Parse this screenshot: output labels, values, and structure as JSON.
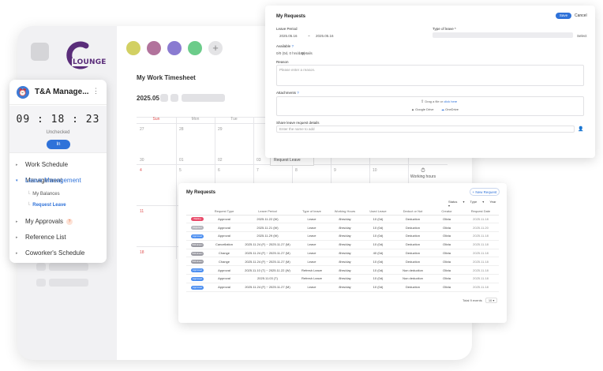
{
  "app": {
    "logo_text": "LOUNGE"
  },
  "colors": {
    "accent": "#2f72d9",
    "logo_purple": "#5a2d7a"
  },
  "theme_dots": [
    {
      "color": "#d2d063",
      "name": "theme-yellow"
    },
    {
      "color": "#b2739c",
      "name": "theme-mauve"
    },
    {
      "color": "#8a7bd1",
      "name": "theme-purple"
    },
    {
      "color": "#6ccc8a",
      "name": "theme-green"
    }
  ],
  "theme_add": "+",
  "timesheet": {
    "title": "My Work Timesheet",
    "month": "2025.05",
    "day_headers": [
      "Sun",
      "Mon",
      "Tue"
    ],
    "week1": [
      "27",
      "28",
      "29"
    ],
    "week2": [
      "30",
      "01",
      "02",
      "03"
    ],
    "week3": [
      "4",
      "5",
      "6",
      "7",
      "8",
      "9",
      "10"
    ],
    "week4": [
      "11"
    ],
    "week5": [
      "18"
    ],
    "popup_item": "Request Leave",
    "work_hours": "Working hours"
  },
  "sidebar": {
    "title": "T&A Manage...",
    "clock": "09 : 18 : 23",
    "status": "Unchecked",
    "in_button": "In",
    "menu": [
      {
        "label": "Work Schedule Management"
      },
      {
        "label": "Leave Management"
      },
      {
        "label": "My Approvals"
      },
      {
        "label": "Reference List"
      },
      {
        "label": "Coworker's Schedule"
      }
    ],
    "sub_menu": [
      {
        "label": "My Balances"
      },
      {
        "label": "Request Leave"
      }
    ],
    "approvals_badge": "?"
  },
  "request_form": {
    "title": "My Requests",
    "save": "Save",
    "cancel": "Cancel",
    "leave_period_label": "Leave Period",
    "date_from": "2025.05.16",
    "date_sep": "~",
    "date_to": "2025.05.16",
    "type_label": "Type of leave *",
    "type_select": "Select",
    "available_label": "Available",
    "available_value": "0/0 (0d, 0 hrs/day)",
    "available_link": "Details",
    "reason_label": "Reason",
    "reason_placeholder": "Please enter a reason.",
    "attachments_label": "Attachments",
    "drag_text": "Drag a file or",
    "click_here": "click here",
    "google_drive": "Google Drive",
    "onedrive": "OneDrive",
    "share_label": "Share leave request details",
    "share_placeholder": "Enter the name to add"
  },
  "requests_table": {
    "title": "My Requests",
    "new_button": "+ New Request",
    "filters": [
      "Status",
      "Type",
      "Year"
    ],
    "headers": [
      "",
      "Request Type",
      "Leave Period",
      "Type of leave",
      "Working Hours",
      "Used Leave",
      "Deduct or Not",
      "Creator",
      "Request Date"
    ],
    "rows": [
      {
        "status": "Waiting",
        "color": "#e94b6a",
        "type": "Approval",
        "period": "2025.11.22 (W)",
        "leave": "Leave",
        "hours": "8hrs/day",
        "used": "10 (0d)",
        "deduct": "Deduction",
        "creator": "Olivia",
        "date": "2025.11.18"
      },
      {
        "status": "Rejected",
        "color": "#b5b5bb",
        "type": "Approval",
        "period": "2025.11.21 (W)",
        "leave": "Leave",
        "hours": "8hrs/day",
        "used": "10 (0d)",
        "deduct": "Deduction",
        "creator": "Olivia",
        "date": "2025.11.20"
      },
      {
        "status": "Approved",
        "color": "#4d8ff0",
        "type": "Approval",
        "period": "2025.11.29 (W)",
        "leave": "Leave",
        "hours": "8hrs/day",
        "used": "10 (0d)",
        "deduct": "Deduction",
        "creator": "Olivia",
        "date": "2025.11.18"
      },
      {
        "status": "Withdrawn",
        "color": "#9a9aa2",
        "type": "Cancellation",
        "period": "2025.11.24 (F) ~ 2025.11.27 (M)",
        "leave": "Leave",
        "hours": "8hrs/day",
        "used": "10 (0d)",
        "deduct": "Deduction",
        "creator": "Olivia",
        "date": "2025.11.18"
      },
      {
        "status": "Withdrawn",
        "color": "#9a9aa2",
        "type": "Change",
        "period": "2025.11.24 (F) ~ 2025.11.27 (M)",
        "leave": "Leave",
        "hours": "8hrs/day",
        "used": "40 (0d)",
        "deduct": "Deduction",
        "creator": "Olivia",
        "date": "2025.11.18"
      },
      {
        "status": "Withdrawn",
        "color": "#9a9aa2",
        "type": "Change",
        "period": "2025.11.24 (F) ~ 2025.11.27 (M)",
        "leave": "Leave",
        "hours": "8hrs/day",
        "used": "10 (0d)",
        "deduct": "Deduction",
        "creator": "Olivia",
        "date": "2025.11.18"
      },
      {
        "status": "Approved",
        "color": "#4d8ff0",
        "type": "Approval",
        "period": "2025.11.10 (T) ~ 2025.11.22 (W)",
        "leave": "Refresh Leave",
        "hours": "8hrs/day",
        "used": "10 (0d)",
        "deduct": "Non deduction",
        "creator": "Olivia",
        "date": "2025.11.18"
      },
      {
        "status": "Approved",
        "color": "#4d8ff0",
        "type": "Approval",
        "period": "2025.11.03 (T)",
        "leave": "Refresh Leave",
        "hours": "8hrs/day",
        "used": "10 (0d)",
        "deduct": "Non deduction",
        "creator": "Olivia",
        "date": "2025.11.18"
      },
      {
        "status": "Approved",
        "color": "#4d8ff0",
        "type": "Approval",
        "period": "2025.11.24 (F) ~ 2025.11.27 (M)",
        "leave": "Leave",
        "hours": "8hrs/day",
        "used": "10 (0d)",
        "deduct": "Deduction",
        "creator": "Olivia",
        "date": "2025.11.18"
      }
    ],
    "total_label": "Total",
    "total_value": "9 events",
    "per_page": "10"
  }
}
